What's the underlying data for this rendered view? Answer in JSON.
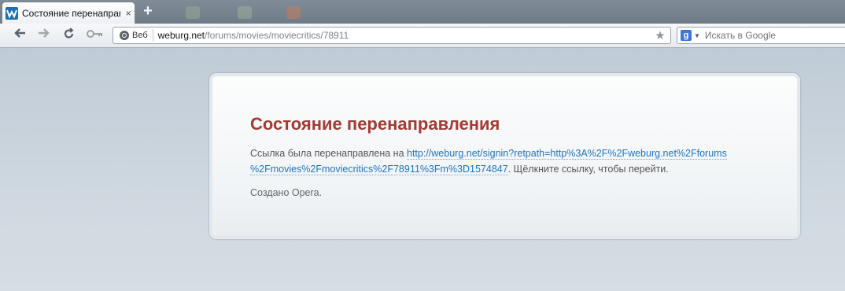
{
  "tab": {
    "title": "Состояние перенаправ...",
    "close_glyph": "×",
    "favicon": "weburg-favicon"
  },
  "new_tab_glyph": "+",
  "toolbar": {
    "back_icon": "back-arrow-icon",
    "forward_icon": "forward-arrow-icon",
    "reload_icon": "reload-icon",
    "key_icon": "key-icon",
    "web_badge_label": "Веб",
    "url_host": "weburg.net",
    "url_path": "/forums/movies/moviecritics/78911",
    "star_icon": "star-icon"
  },
  "search": {
    "engine_letter": "g",
    "placeholder": "Искать в Google"
  },
  "page": {
    "title": "Состояние перенаправления",
    "message_prefix": "Ссылка была перенаправлена на ",
    "link_line1": "http://weburg.net/signin?retpath=http%3A%2F%2Fweburg.net%2Fforums",
    "link_line2": "%2Fmovies%2Fmoviecritics%2F78911%3Fm%3D1574847",
    "message_suffix": ". Щёлкните ссылку, чтобы перейти.",
    "credit": "Создано Opera."
  },
  "colors": {
    "title_red": "#a43a34",
    "link_blue": "#1f74c4",
    "page_bg": "#c8d2dc"
  }
}
